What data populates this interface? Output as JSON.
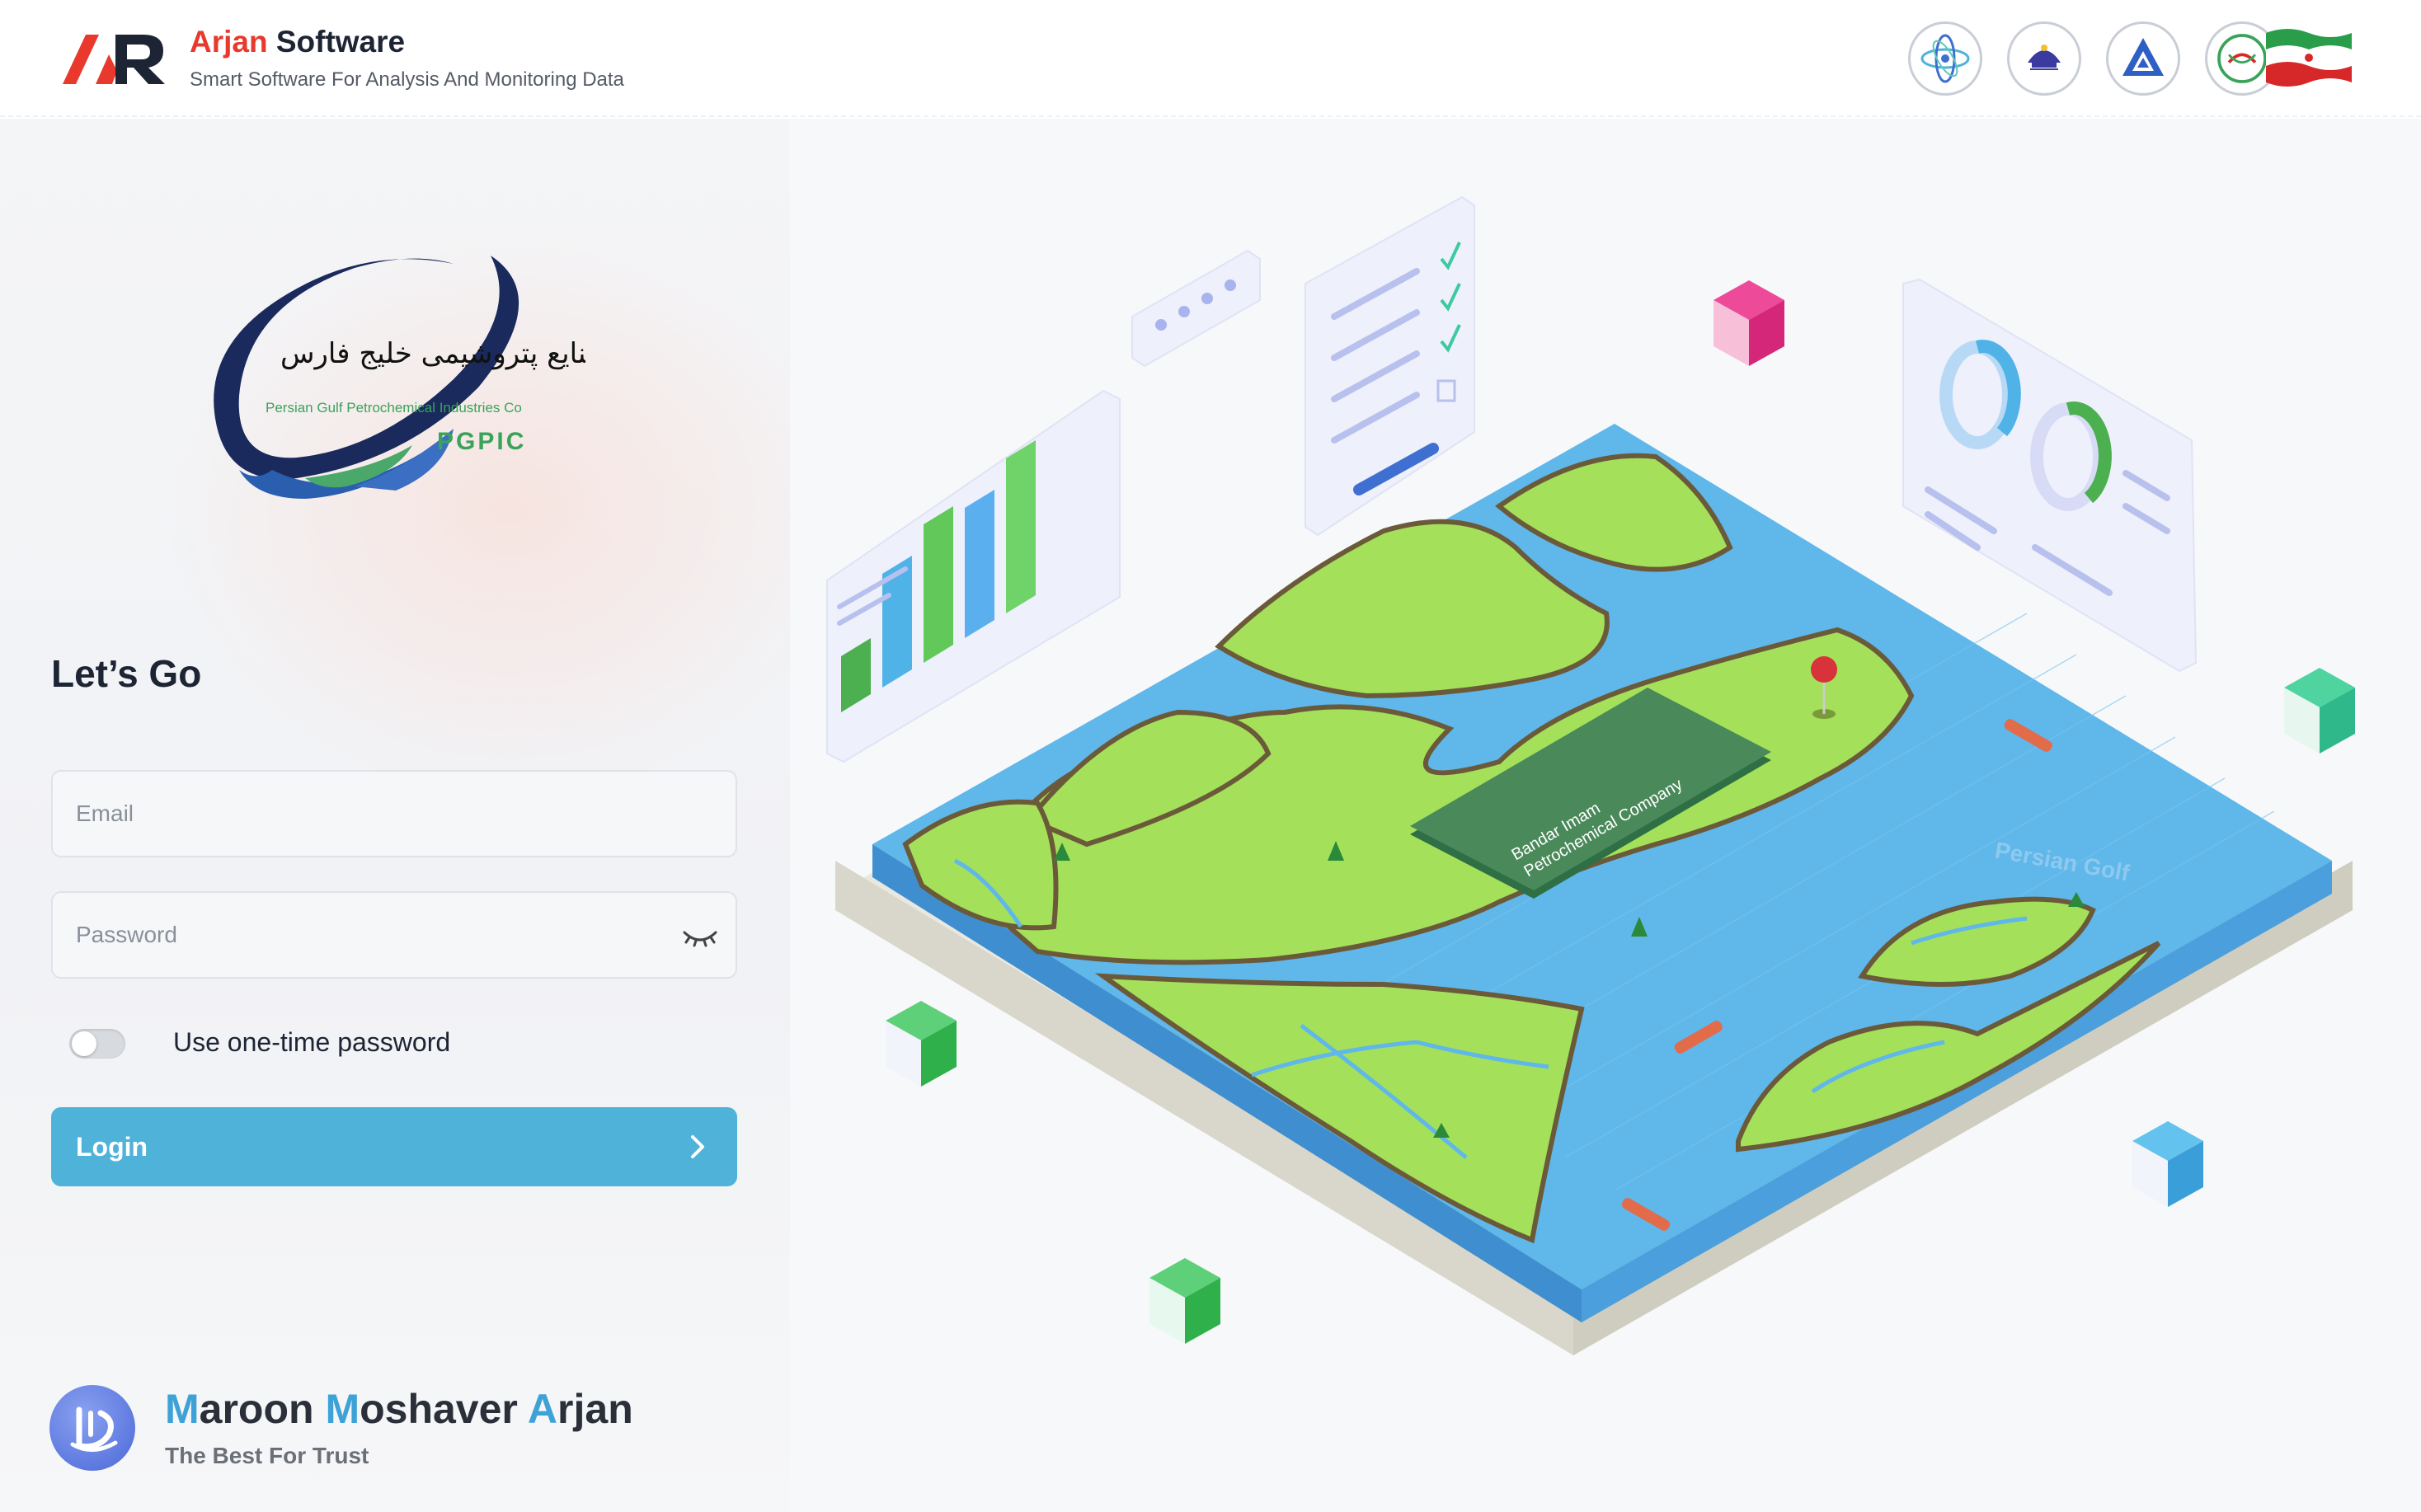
{
  "header": {
    "brand_accent": "Arjan",
    "brand_rest": "Software",
    "subtitle": "Smart Software For Analysis And Monitoring Data",
    "partner_logos": [
      "atom-logo",
      "university-logo",
      "triangle-a-logo",
      "iran-flag-logo"
    ]
  },
  "company": {
    "name_fa": "شرکت صنایع پتروشیمی خلیج فارس",
    "name_en": "Persian Gulf Petrochemical Industries Co",
    "abbr": "PGPIC"
  },
  "login": {
    "title": "Let’s Go",
    "email_placeholder": "Email",
    "password_placeholder": "Password",
    "otp_label": "Use one-time password",
    "otp_enabled": false,
    "login_label": "Login"
  },
  "footer": {
    "title_parts": [
      "M",
      "aroon ",
      "M",
      "oshaver ",
      "A",
      "rjan"
    ],
    "subtitle": "The Best For Trust"
  },
  "illustration": {
    "company_label_line1": "Bandar Imam",
    "company_label_line2": "Petrochemical Company",
    "sea_label": "Persian Golf"
  },
  "colors": {
    "brand_red": "#e8392c",
    "primary_blue": "#4fb3d9",
    "land_green": "#a4e05a",
    "sea_blue": "#5fb7ea",
    "pgpic_green": "#3aa35a"
  }
}
